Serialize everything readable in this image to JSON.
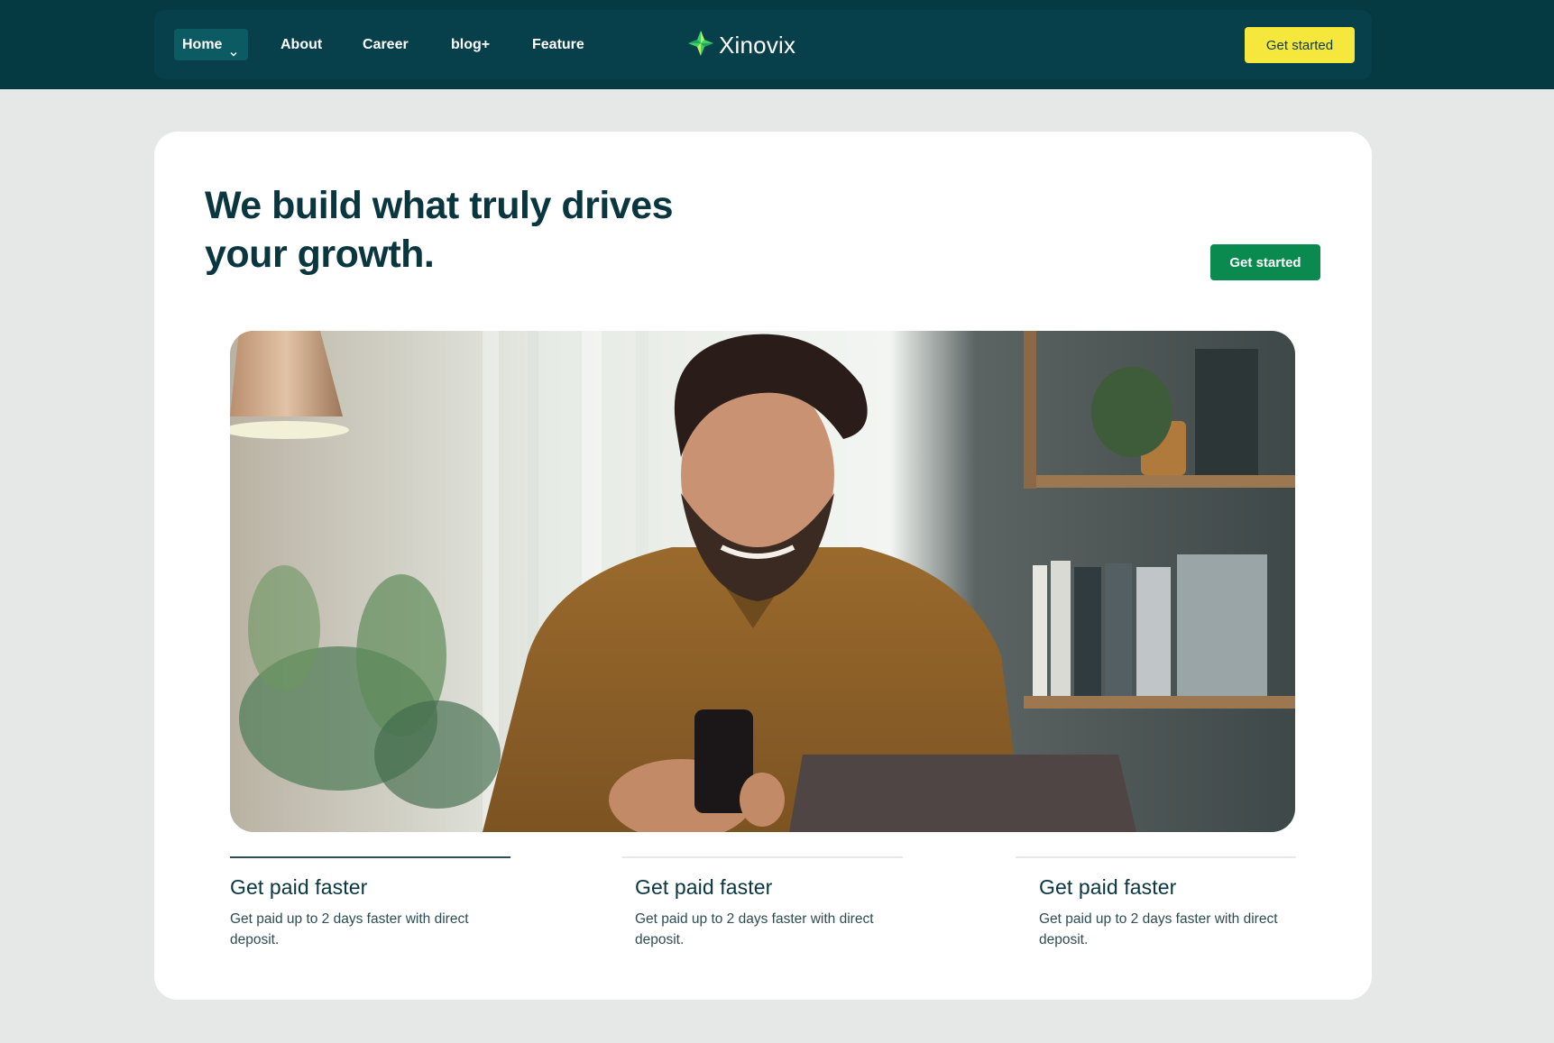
{
  "nav": {
    "items": [
      {
        "label": "Home",
        "active": true
      },
      {
        "label": "About"
      },
      {
        "label": "Career"
      },
      {
        "label": "blog+"
      },
      {
        "label": "Feature"
      }
    ],
    "brand": "Xinovix",
    "cta_label": "Get started"
  },
  "hero": {
    "headline": "We build what truly drives your growth.",
    "cta_label": "Get started",
    "image_icon": "photo-man-smiling-at-phone"
  },
  "features": [
    {
      "title": "Get paid faster",
      "desc": "Get paid up to 2 days faster with direct deposit.",
      "active": true
    },
    {
      "title": "Get paid faster",
      "desc": "Get paid up to 2 days faster with direct deposit."
    },
    {
      "title": "Get paid faster",
      "desc": "Get paid up to 2 days faster with direct deposit."
    }
  ],
  "colors": {
    "header_bg": "#053a43",
    "accent_yellow": "#f5e73c",
    "accent_green": "#0a8a4f",
    "page_bg": "#e6e8e7"
  }
}
